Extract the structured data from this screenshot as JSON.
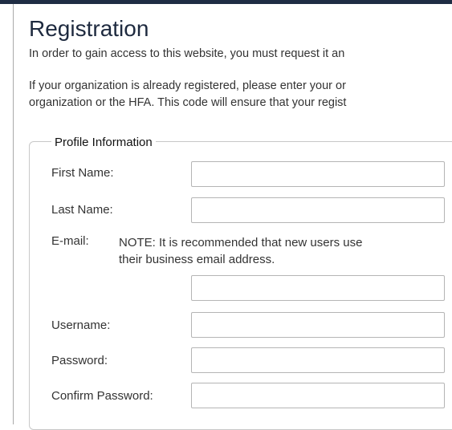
{
  "page": {
    "title": "Registration",
    "intro": "In order to gain access to this website, you must request it an",
    "org_line_1": "If your organization is already registered, please enter your or",
    "org_line_2": "organization or the HFA. This code will ensure that your regist"
  },
  "form": {
    "legend": "Profile Information",
    "first_name_label": "First Name:",
    "first_name_value": "",
    "last_name_label": "Last Name:",
    "last_name_value": "",
    "email_label": "E-mail:",
    "email_note_line_1": "NOTE: It is recommended that new users use",
    "email_note_line_2": "their business email address.",
    "email_value": "",
    "username_label": "Username:",
    "username_value": "",
    "password_label": "Password:",
    "password_value": "",
    "confirm_password_label": "Confirm Password:",
    "confirm_password_value": ""
  }
}
